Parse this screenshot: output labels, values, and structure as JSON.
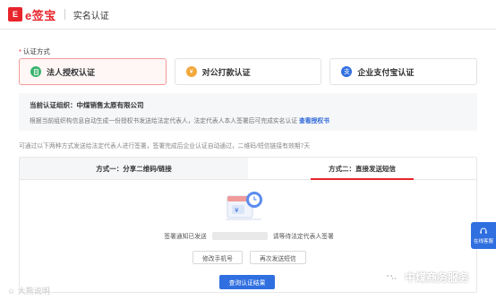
{
  "header": {
    "logo_mark": "E",
    "logo_text": "e签宝",
    "title": "实名认证"
  },
  "auth_method": {
    "label_star": "*",
    "label": "认证方式",
    "options": [
      {
        "label": "法人授权认证",
        "icon": "document-icon",
        "color": "#3bb46f",
        "active": true
      },
      {
        "label": "对公打款认证",
        "icon": "coin-icon",
        "color": "#f3a83b",
        "active": false
      },
      {
        "label": "企业支付宝认证",
        "icon": "alipay-icon",
        "color": "#2f6fe0",
        "active": false
      }
    ]
  },
  "info": {
    "org_line": "当前认证组织：中煤销售太原有限公司",
    "desc": "根据当前组织构信息自动生成一份授权书发送给法定代表人，法定代表人本人签署后可完成实名认证",
    "link": "查看授权书"
  },
  "hint": "可通过以下两种方式发送给法定代表人进行签署，签署完成后企业认证自动通过，二维码/短信链接有效期7天",
  "tabs": [
    {
      "label": "方式一：分享二维码/链接",
      "active": false
    },
    {
      "label": "方式二：直接发送短信",
      "active": true
    }
  ],
  "status": {
    "before": "签署通知已发送",
    "after": "请等待法定代表人签署"
  },
  "buttons": {
    "modify_phone": "修改手机号",
    "resend": "再次发送短信",
    "check_result": "查询认证结果"
  },
  "float_service": {
    "label": "在线客服"
  },
  "watermarks": {
    "left": "☺ 大熊说明",
    "right": "中煤商务服务"
  },
  "colors": {
    "brand_red": "#e8242b",
    "primary_blue": "#2f6fe0",
    "link_blue": "#2f68d8"
  }
}
